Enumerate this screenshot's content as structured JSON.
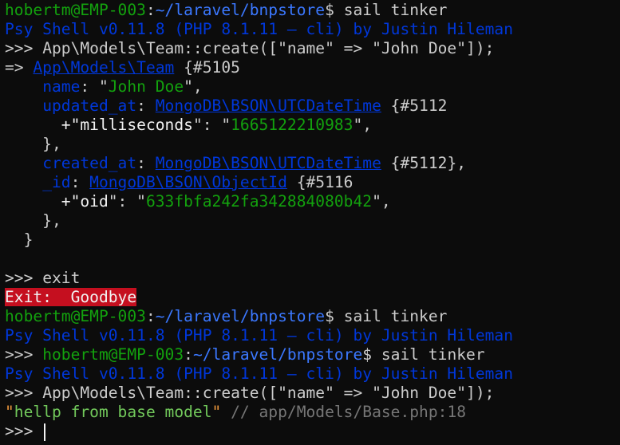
{
  "prompt": {
    "user_host": "hobertm@EMP-003",
    "sep": ":",
    "path": "~/laravel/bnpstore",
    "dollar": "$ ",
    "command": "sail tinker"
  },
  "psysh_banner": "Psy Shell v0.11.8 (PHP 8.1.11 — cli) by Justin Hileman",
  "repl_prompt": ">>> ",
  "create_command": "App\\Models\\Team::create([\"name\" => \"John Doe\"]);",
  "result": {
    "arrow": "=> ",
    "class": "App\\Models\\Team",
    "ref": " {#5105",
    "name_key": "name",
    "name_val": "John Doe",
    "updated_key": "updated_at",
    "datetime_class": "MongoDB\\BSON\\UTCDateTime",
    "updated_ref": " {#5112",
    "ms_key": "milliseconds",
    "ms_val": "1665122210983",
    "created_key": "created_at",
    "created_ref": " {#5112},",
    "id_key": "_id",
    "objectid_class": "MongoDB\\BSON\\ObjectId",
    "id_ref": " {#5116",
    "oid_key": "oid",
    "oid_val": "633fbfa242fa342884080b42"
  },
  "exit_command": "exit",
  "exit_message": "Exit:  Goodbye",
  "base_output": {
    "string": "hellp from base model",
    "comment": " // app/Models/Base.php:18"
  }
}
